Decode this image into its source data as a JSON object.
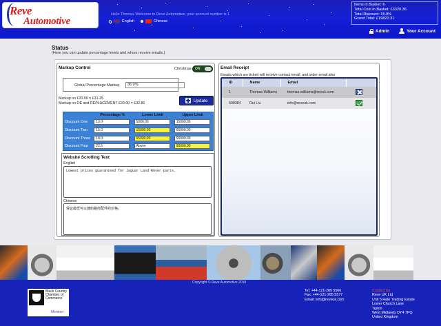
{
  "header": {
    "logo_line1": "Reve",
    "logo_line2": "Automotive",
    "welcome": "Hello Thomas Welcome to Reve Automotive, your account number is 1",
    "languages": [
      "English",
      "Chinese"
    ],
    "basket": {
      "items": "Items in Basket: 6",
      "total_cost": "Total Cost in Basket: £3320.36",
      "total_discount": "Total Discount: 15.0%",
      "grand_total": "Grand Total: £19822.31"
    },
    "admin_link": "Admin",
    "account_link": "Your Account"
  },
  "page": {
    "title": "Status",
    "subtitle": "(Here you can update percentage levels and whom receive emails.)"
  },
  "markup": {
    "title": "Markup Control",
    "christmas_label": "Christmas",
    "toggle_value": "ON",
    "global_label": "Global Percentage Markup",
    "global_value": "36.0%",
    "note1": "Markup on £20.00 = £31.25",
    "note2": "Markup on OE and REPLACEMENT £20.00 = £32.81",
    "update_label": "Update",
    "discount_headers": [
      "",
      "Percentage %",
      "Lower Limit",
      "Upper Limit"
    ],
    "discounts": [
      {
        "name": "Discount One",
        "percent": "10.0",
        "lower": "5000.00",
        "upper": "15000.00",
        "lower_hl": false,
        "upper_hl": false
      },
      {
        "name": "Discount Two",
        "percent": "15.0",
        "lower": "15000.00",
        "upper": "65000.00",
        "lower_hl": true,
        "upper_hl": false
      },
      {
        "name": "Discount Three",
        "percent": "18.0",
        "lower": "65000.00",
        "upper": "90000.00",
        "lower_hl": true,
        "upper_hl": false
      },
      {
        "name": "Discount Four",
        "percent": "22.5",
        "lower": "Above",
        "upper": "90000.00",
        "lower_hl": false,
        "upper_hl": true
      }
    ]
  },
  "scrolling": {
    "title": "Website Scrolling Text",
    "english_label": "English",
    "english_text": "Lowest prices guaranteed for Jaguar Land Rover parts.",
    "chinese_label": "Chinese",
    "chinese_text": "保证最低可以捷豹路虎配件的价格。"
  },
  "email": {
    "title": "Email Receipt",
    "subtitle": "Emails which are ticked will receive contact email, and order email also",
    "headers": [
      "ID",
      "Name",
      "Email",
      ""
    ],
    "rows": [
      {
        "id": "1",
        "name": "Thomas Williams",
        "email": "thomas.williams@reeuk.com",
        "icon": "remove-x-icon"
      },
      {
        "id": "600384",
        "name": "Rui Liu",
        "email": "info@reveuk.com",
        "icon": "checked-icon"
      }
    ]
  },
  "footer": {
    "copyright": "Copyright © Reve Automotive 2018",
    "chamber_text": "Black Country Chamber of Commerce",
    "chamber_member": "Member",
    "tel": "Tel: +44-121-285 5566",
    "fax": "Fax: +44-121-285 5577",
    "email": "Email: info@reveuk.com",
    "contact_heading": "Contact Us",
    "address": [
      "Reve UK Ltd",
      "Unit 6 Hale Trading Estate",
      "Lower Church Lane",
      "Tipton",
      "West Midlands DY4 7PQ",
      "United Kingdom"
    ]
  },
  "colors": {
    "header_blue": "#1520d6",
    "footer_blue": "#1722b8",
    "discount_blue": "#3b82d6",
    "highlight_yellow": "#f8f33c",
    "brand_red": "#d8201e"
  }
}
